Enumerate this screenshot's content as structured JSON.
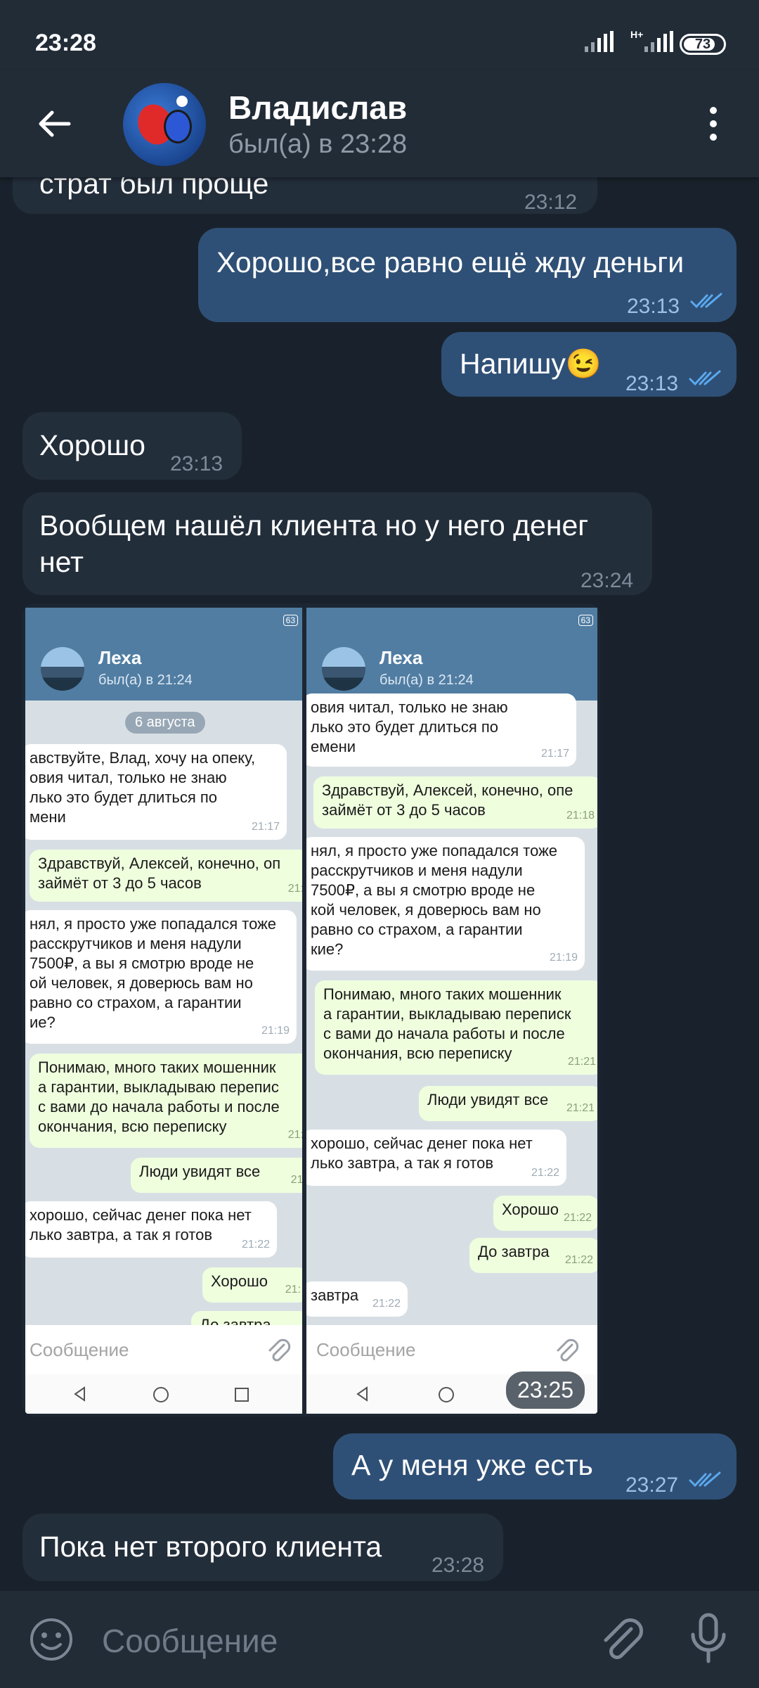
{
  "status_bar": {
    "time": "23:28",
    "network": "H+",
    "battery": "73"
  },
  "header": {
    "name": "Владислав",
    "status": "был(а) в 23:28"
  },
  "messages": [
    {
      "dir": "in",
      "text": "страт был проще",
      "time": "23:12"
    },
    {
      "dir": "out",
      "text": "Хорошо,все равно ещё жду деньги",
      "time": "23:13",
      "read": true
    },
    {
      "dir": "out",
      "text": "Напишу😉",
      "time": "23:13",
      "read": true
    },
    {
      "dir": "in",
      "text": "Хорошо",
      "time": "23:13"
    },
    {
      "dir": "in",
      "text_line1": "Вообщем нашёл клиента но у него денег",
      "text_line2": "нет",
      "time": "23:24"
    },
    {
      "dir": "in",
      "type": "image",
      "time": "23:25"
    },
    {
      "dir": "out",
      "text": "А у меня уже есть",
      "time": "23:27",
      "read": true
    },
    {
      "dir": "in",
      "text": "Пока нет второго клиента",
      "time": "23:28"
    }
  ],
  "screenshot": {
    "left": {
      "name": "Леха",
      "status": "был(а) в 21:24",
      "date": "6 августа",
      "msgs": [
        {
          "lines": [
            "авствуйте,  Влад, хочу на опеку,",
            "овия читал, только не знаю",
            "лько это будет длиться по",
            "мени"
          ],
          "time": "21:17"
        },
        {
          "lines": [
            "Здравствуй, Алексей, конечно, оп",
            "займёт от 3 до 5  часов"
          ],
          "time": "21:"
        },
        {
          "lines": [
            "нял, я просто уже попадался тоже",
            "расскрутчиков и меня надули",
            "7500₽, а вы я смотрю вроде не",
            "ой человек, я доверюсь вам но",
            "равно со страхом, а гарантии",
            "ие?"
          ],
          "time": "21:19"
        },
        {
          "lines": [
            "Понимаю, много таких мошенник",
            "а гарантии, выкладываю перепис",
            "с вами до начала работы и после",
            "окончания, всю переписку"
          ],
          "time": "21:"
        },
        {
          "lines": [
            "Люди увидят все"
          ],
          "time": "21:"
        },
        {
          "lines": [
            "хорошо,  сейчас денег пока нет",
            "лько завтра, а так я готов"
          ],
          "time": "21:22"
        },
        {
          "lines": [
            "Хорошо"
          ],
          "time": "21:"
        },
        {
          "lines": [
            "До завтра"
          ],
          "time": ""
        }
      ],
      "input_placeholder": "Сообщение"
    },
    "right": {
      "name": "Леха",
      "status": "был(а) в 21:24",
      "msgs": [
        {
          "lines": [
            "овия читал, только не знаю",
            "лько это будет длиться по",
            "емени"
          ],
          "time": "21:17"
        },
        {
          "lines": [
            "Здравствуй, Алексей, конечно, опе",
            "займёт от 3 до 5  часов"
          ],
          "time": "21:18"
        },
        {
          "lines": [
            "нял, я просто уже попадался тоже",
            "расскрутчиков и меня надули",
            "7500₽, а вы я смотрю вроде не",
            "кой человек, я доверюсь вам но",
            "равно со страхом, а гарантии",
            "кие?"
          ],
          "time": "21:19"
        },
        {
          "lines": [
            "Понимаю, много таких мошенник",
            "а гарантии, выкладываю переписк",
            "с вами до начала работы и после",
            "окончания, всю переписку"
          ],
          "time": "21:21"
        },
        {
          "lines": [
            "Люди увидят все"
          ],
          "time": "21:21"
        },
        {
          "lines": [
            "хорошо,  сейчас денег пока нет",
            "лько завтра, а так я готов"
          ],
          "time": "21:22"
        },
        {
          "lines": [
            "Хорошо"
          ],
          "time": "21:22"
        },
        {
          "lines": [
            "До завтра"
          ],
          "time": "21:22"
        },
        {
          "lines": [
            "завтра"
          ],
          "time": "21:22"
        }
      ],
      "input_placeholder": "Сообщение"
    }
  },
  "input": {
    "placeholder": "Сообщение"
  },
  "colors": {
    "background": "#19222c",
    "header": "#222c37",
    "incoming": "#232e3b",
    "outgoing": "#2f5076",
    "read_check": "#5aa9f0"
  }
}
